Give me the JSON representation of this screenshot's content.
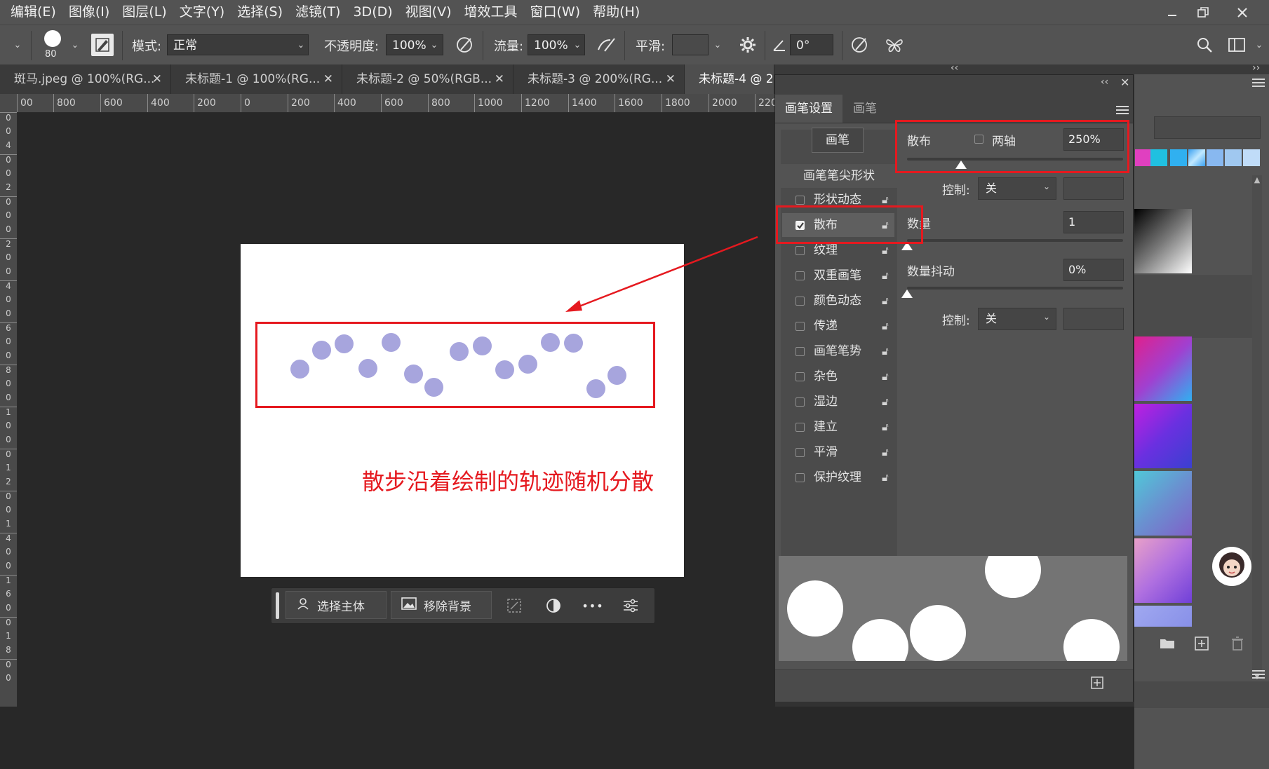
{
  "menubar": {
    "items": [
      "编辑(E)",
      "图像(I)",
      "图层(L)",
      "文字(Y)",
      "选择(S)",
      "滤镜(T)",
      "3D(D)",
      "视图(V)",
      "增效工具",
      "窗口(W)",
      "帮助(H)"
    ]
  },
  "options": {
    "brush_size": "80",
    "mode_label": "模式:",
    "mode_value": "正常",
    "opacity_label": "不透明度:",
    "opacity_value": "100%",
    "flow_label": "流量:",
    "flow_value": "100%",
    "smooth_label": "平滑:",
    "smooth_value": "",
    "angle_value": "0°"
  },
  "tabs": [
    {
      "label": "斑马.jpeg @ 100%(RG..."
    },
    {
      "label": "未标题-1 @ 100%(RG..."
    },
    {
      "label": "未标题-2 @ 50%(RGB..."
    },
    {
      "label": "未标题-3 @ 200%(RG..."
    },
    {
      "label": "未标题-4 @ 2"
    }
  ],
  "ruler_top": [
    "00",
    "800",
    "600",
    "400",
    "200",
    "0",
    "200",
    "400",
    "600",
    "800",
    "1000",
    "1200",
    "1400",
    "1600",
    "1800",
    "2000",
    "220"
  ],
  "ruler_left": [
    "0",
    "0",
    "4",
    "0",
    "0",
    "2",
    "0",
    "0",
    "0",
    "2",
    "0",
    "0",
    "4",
    "0",
    "0",
    "6",
    "0",
    "0",
    "8",
    "0",
    "0",
    "1",
    "0",
    "0",
    "0",
    "1",
    "2",
    "0",
    "0",
    "1",
    "4",
    "0",
    "0",
    "1",
    "6",
    "0",
    "0",
    "1",
    "8",
    "0",
    "0"
  ],
  "annotation_text": "散步沿着绘制的轨迹随机分散",
  "context_bar": {
    "select_subject": "选择主体",
    "remove_bg": "移除背景",
    "more": "•••"
  },
  "brush_panel": {
    "tab_settings": "画笔设置",
    "tab_brush": "画笔",
    "brush_button": "画笔",
    "tip_shape": "画笔笔尖形状",
    "items": [
      {
        "label": "形状动态",
        "checked": false
      },
      {
        "label": "散布",
        "checked": true
      },
      {
        "label": "纹理",
        "checked": false
      },
      {
        "label": "双重画笔",
        "checked": false
      },
      {
        "label": "颜色动态",
        "checked": false
      },
      {
        "label": "传递",
        "checked": false
      },
      {
        "label": "画笔笔势",
        "checked": false
      },
      {
        "label": "杂色",
        "checked": false
      },
      {
        "label": "湿边",
        "checked": false
      },
      {
        "label": "建立",
        "checked": false
      },
      {
        "label": "平滑",
        "checked": false
      },
      {
        "label": "保护纹理",
        "checked": false
      }
    ],
    "scatter_label": "散布",
    "both_axes_label": "两轴",
    "scatter_value": "250%",
    "scatter_fraction": 0.25,
    "control_label": "控制:",
    "control_value": "关",
    "count_label": "数量",
    "count_value": "1",
    "count_jitter_label": "数量抖动",
    "count_jitter_value": "0%",
    "control2_label": "控制:",
    "control2_value": "关"
  },
  "colors": {
    "accent_red": "#e5191f",
    "dot_color": "#a7a5dd",
    "panel_bg": "#535353"
  }
}
